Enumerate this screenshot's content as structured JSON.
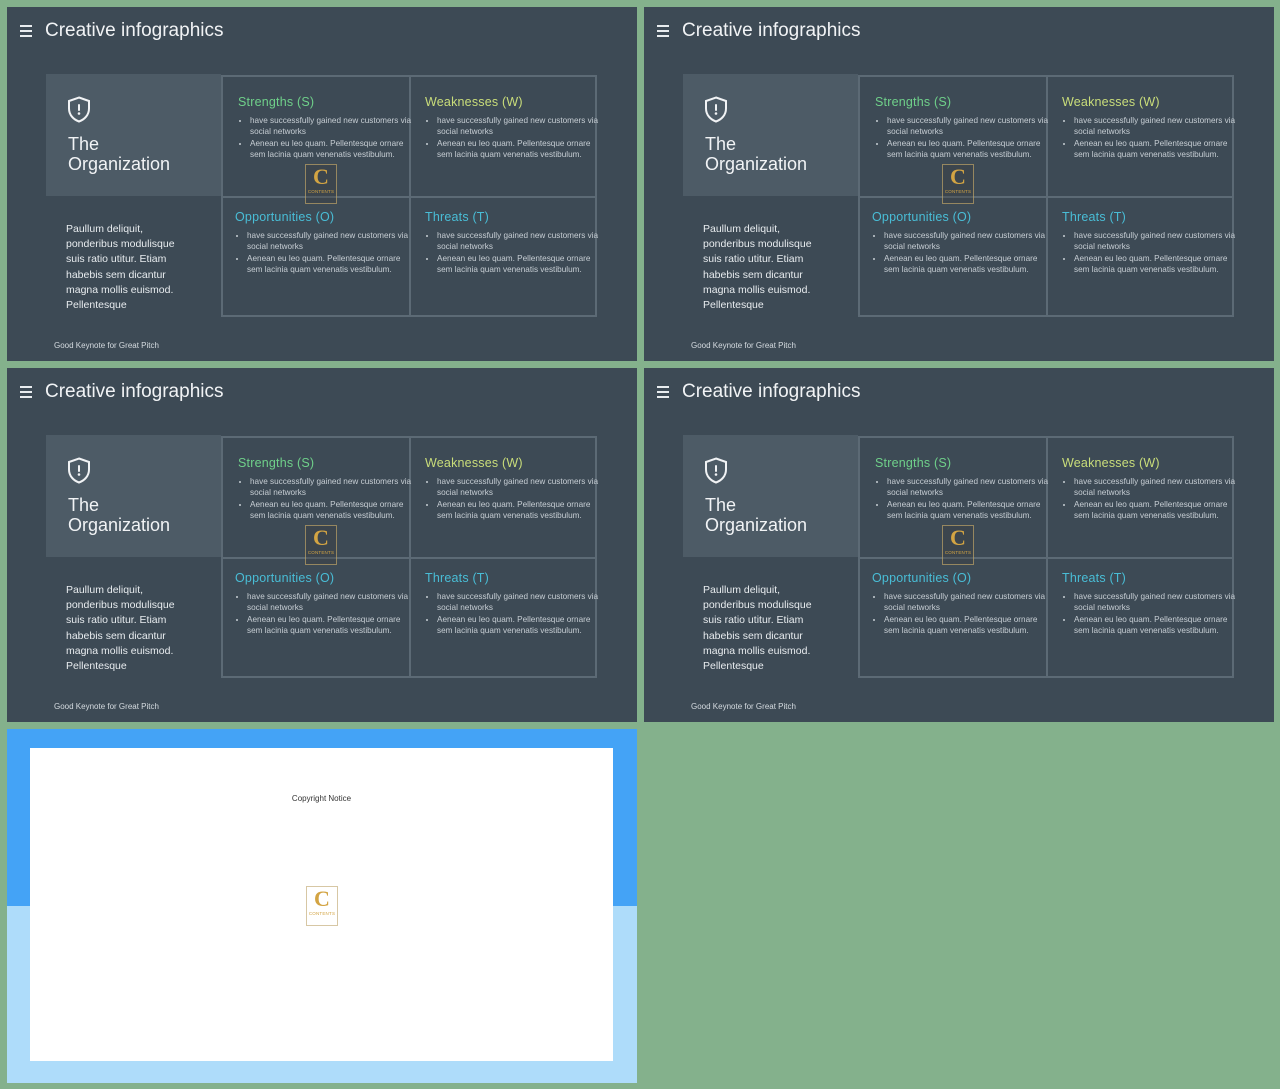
{
  "slides": [
    {
      "title": "Creative infographics",
      "org_line1": "The",
      "org_line2": "Organization",
      "description": "Paullum deliquit, ponderibus modulisque suis ratio utitur. Etiam habebis sem dicantur magna mollis euismod. Pellentesque",
      "footer": "Good Keynote for Great Pitch",
      "swot": {
        "strengths": {
          "title": "Strengths (S)",
          "bullet1": "have successfully gained new customers via social networks",
          "bullet2": "Aenean eu leo quam. Pellentesque ornare sem lacinia quam venenatis vestibulum."
        },
        "weaknesses": {
          "title": "Weaknesses (W)",
          "bullet1": "have successfully gained new customers via social networks",
          "bullet2": "Aenean eu leo quam. Pellentesque ornare sem lacinia quam venenatis vestibulum."
        },
        "opportunities": {
          "title": "Opportunities (O)",
          "bullet1": "have successfully gained new customers via social networks",
          "bullet2": "Aenean eu leo quam. Pellentesque ornare sem lacinia quam venenatis vestibulum."
        },
        "threats": {
          "title": "Threats (T)",
          "bullet1": "have successfully gained new customers via social networks",
          "bullet2": "Aenean eu leo quam. Pellentesque ornare sem lacinia quam venenatis vestibulum."
        }
      }
    },
    {
      "title": "Creative infographics",
      "org_line1": "The",
      "org_line2": "Organization",
      "description": "Paullum deliquit, ponderibus modulisque suis ratio utitur. Etiam habebis sem dicantur magna mollis euismod. Pellentesque",
      "footer": "Good Keynote for Great Pitch",
      "swot": {
        "strengths": {
          "title": "Strengths (S)",
          "bullet1": "have successfully gained new customers via social networks",
          "bullet2": "Aenean eu leo quam. Pellentesque ornare sem lacinia quam venenatis vestibulum."
        },
        "weaknesses": {
          "title": "Weaknesses (W)",
          "bullet1": "have successfully gained new customers via social networks",
          "bullet2": "Aenean eu leo quam. Pellentesque ornare sem lacinia quam venenatis vestibulum."
        },
        "opportunities": {
          "title": "Opportunities (O)",
          "bullet1": "have successfully gained new customers via social networks",
          "bullet2": "Aenean eu leo quam. Pellentesque ornare sem lacinia quam venenatis vestibulum."
        },
        "threats": {
          "title": "Threats (T)",
          "bullet1": "have successfully gained new customers via social networks",
          "bullet2": "Aenean eu leo quam. Pellentesque ornare sem lacinia quam venenatis vestibulum."
        }
      }
    },
    {
      "title": "Creative infographics",
      "org_line1": "The",
      "org_line2": "Organization",
      "description": "Paullum deliquit, ponderibus modulisque suis ratio utitur. Etiam habebis sem dicantur magna mollis euismod. Pellentesque",
      "footer": "Good Keynote for Great Pitch",
      "swot": {
        "strengths": {
          "title": "Strengths (S)",
          "bullet1": "have successfully gained new customers via social networks",
          "bullet2": "Aenean eu leo quam. Pellentesque ornare sem lacinia quam venenatis vestibulum."
        },
        "weaknesses": {
          "title": "Weaknesses (W)",
          "bullet1": "have successfully gained new customers via social networks",
          "bullet2": "Aenean eu leo quam. Pellentesque ornare sem lacinia quam venenatis vestibulum."
        },
        "opportunities": {
          "title": "Opportunities (O)",
          "bullet1": "have successfully gained new customers via social networks",
          "bullet2": "Aenean eu leo quam. Pellentesque ornare sem lacinia quam venenatis vestibulum."
        },
        "threats": {
          "title": "Threats (T)",
          "bullet1": "have successfully gained new customers via social networks",
          "bullet2": "Aenean eu leo quam. Pellentesque ornare sem lacinia quam venenatis vestibulum."
        }
      }
    },
    {
      "title": "Creative infographics",
      "org_line1": "The",
      "org_line2": "Organization",
      "description": "Paullum deliquit, ponderibus modulisque suis ratio utitur. Etiam habebis sem dicantur magna mollis euismod. Pellentesque",
      "footer": "Good Keynote for Great Pitch",
      "swot": {
        "strengths": {
          "title": "Strengths (S)",
          "bullet1": "have successfully gained new customers via social networks",
          "bullet2": "Aenean eu leo quam. Pellentesque ornare sem lacinia quam venenatis vestibulum."
        },
        "weaknesses": {
          "title": "Weaknesses (W)",
          "bullet1": "have successfully gained new customers via social networks",
          "bullet2": "Aenean eu leo quam. Pellentesque ornare sem lacinia quam venenatis vestibulum."
        },
        "opportunities": {
          "title": "Opportunities (O)",
          "bullet1": "have successfully gained new customers via social networks",
          "bullet2": "Aenean eu leo quam. Pellentesque ornare sem lacinia quam venenatis vestibulum."
        },
        "threats": {
          "title": "Threats (T)",
          "bullet1": "have successfully gained new customers via social networks",
          "bullet2": "Aenean eu leo quam. Pellentesque ornare sem lacinia quam venenatis vestibulum."
        }
      }
    }
  ],
  "watermark": {
    "letter": "C",
    "text": "CONTENTS"
  },
  "copyright": {
    "title": "Copyright Notice"
  },
  "icons": {
    "menu": "menu-icon",
    "shield": "shield-icon"
  },
  "colors": {
    "page_bg": "#84b18c",
    "slide_bg": "#3d4a55",
    "panel_bg": "#4d5b66",
    "strengths": "#6fd08a",
    "weaknesses": "#c9dd7a",
    "opportunities": "#49bdd6",
    "threats": "#49bdd6",
    "copyright_top": "#44a3f6",
    "copyright_bottom": "#aedcfa"
  }
}
